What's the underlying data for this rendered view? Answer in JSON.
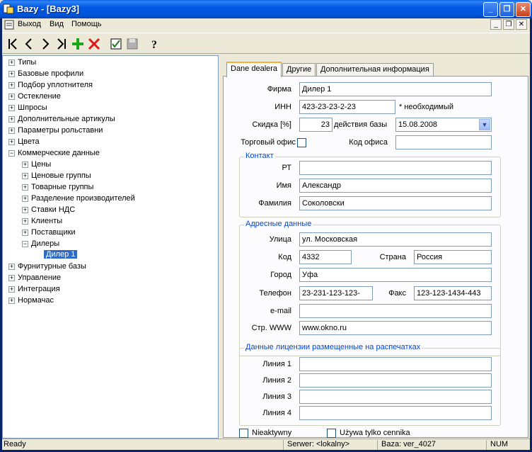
{
  "window": {
    "title": "Bazy - [Bazy3]"
  },
  "menu": {
    "items": [
      "Выход",
      "Вид",
      "Помощь"
    ]
  },
  "tree": {
    "top_items": [
      "Типы",
      "Базовые профили",
      "Подбор уплотнителя",
      "Остекление",
      "Шпросы",
      "Дополнительные артикулы",
      "Параметры рольставни",
      "Цвета",
      "Коммерческие данные"
    ],
    "commercial_children": [
      "Цены",
      "Ценовые группы",
      "Товарные группы",
      "Разделение производителей",
      "Ставки НДС",
      "Клиенты",
      "Поставщики",
      "Дилеры"
    ],
    "dealer_child": "Дилер 1",
    "bottom_items": [
      "Фурнитурные базы",
      "Управление",
      "Интеграция",
      "Нормачас"
    ]
  },
  "tabs": [
    "Dane dealera",
    "Другие",
    "Дополнительная информация"
  ],
  "form": {
    "firma_label": "Фирма",
    "firma_value": "Дилер 1",
    "inn_label": "ИНН",
    "inn_value": "423-23-23-2-23",
    "inn_note": "* необходимый",
    "skidka_label": "Скидка [%]",
    "skidka_value": "23",
    "validity_label": "действия базы",
    "validity_value": "15.08.2008",
    "office_label": "Торговый офис",
    "office_code_label": "Код офиса",
    "office_code_value": "",
    "contact_title": "Контакт",
    "rt_label": "РТ",
    "rt_value": "",
    "name_label": "Имя",
    "name_value": "Александр",
    "surname_label": "Фамилия",
    "surname_value": "Соколовски",
    "address_title": "Адресные данные",
    "street_label": "Улица",
    "street_value": "ул. Московская",
    "code_label": "Код",
    "code_value": "4332",
    "country_label": "Страна",
    "country_value": "Россия",
    "city_label": "Город",
    "city_value": "Уфа",
    "phone_label": "Телефон",
    "phone_value": "23-231-123-123-",
    "fax_label": "Факс",
    "fax_value": "123-123-1434-443",
    "email_label": "e-mail",
    "email_value": "",
    "www_label": "Стр. WWW",
    "www_value": "www.okno.ru",
    "license_title": "Данные лицензии размещенные на распечатках",
    "line1_label": "Линия 1",
    "line2_label": "Линия 2",
    "line3_label": "Линия 3",
    "line4_label": "Линия 4",
    "inactive_label": "Nieaktywny",
    "only_price_label": "Używa tylko cennika"
  },
  "status": {
    "ready": "Ready",
    "server": "Serwer: <lokalny>",
    "base": "Baza: ver_4027",
    "num": "NUM"
  }
}
